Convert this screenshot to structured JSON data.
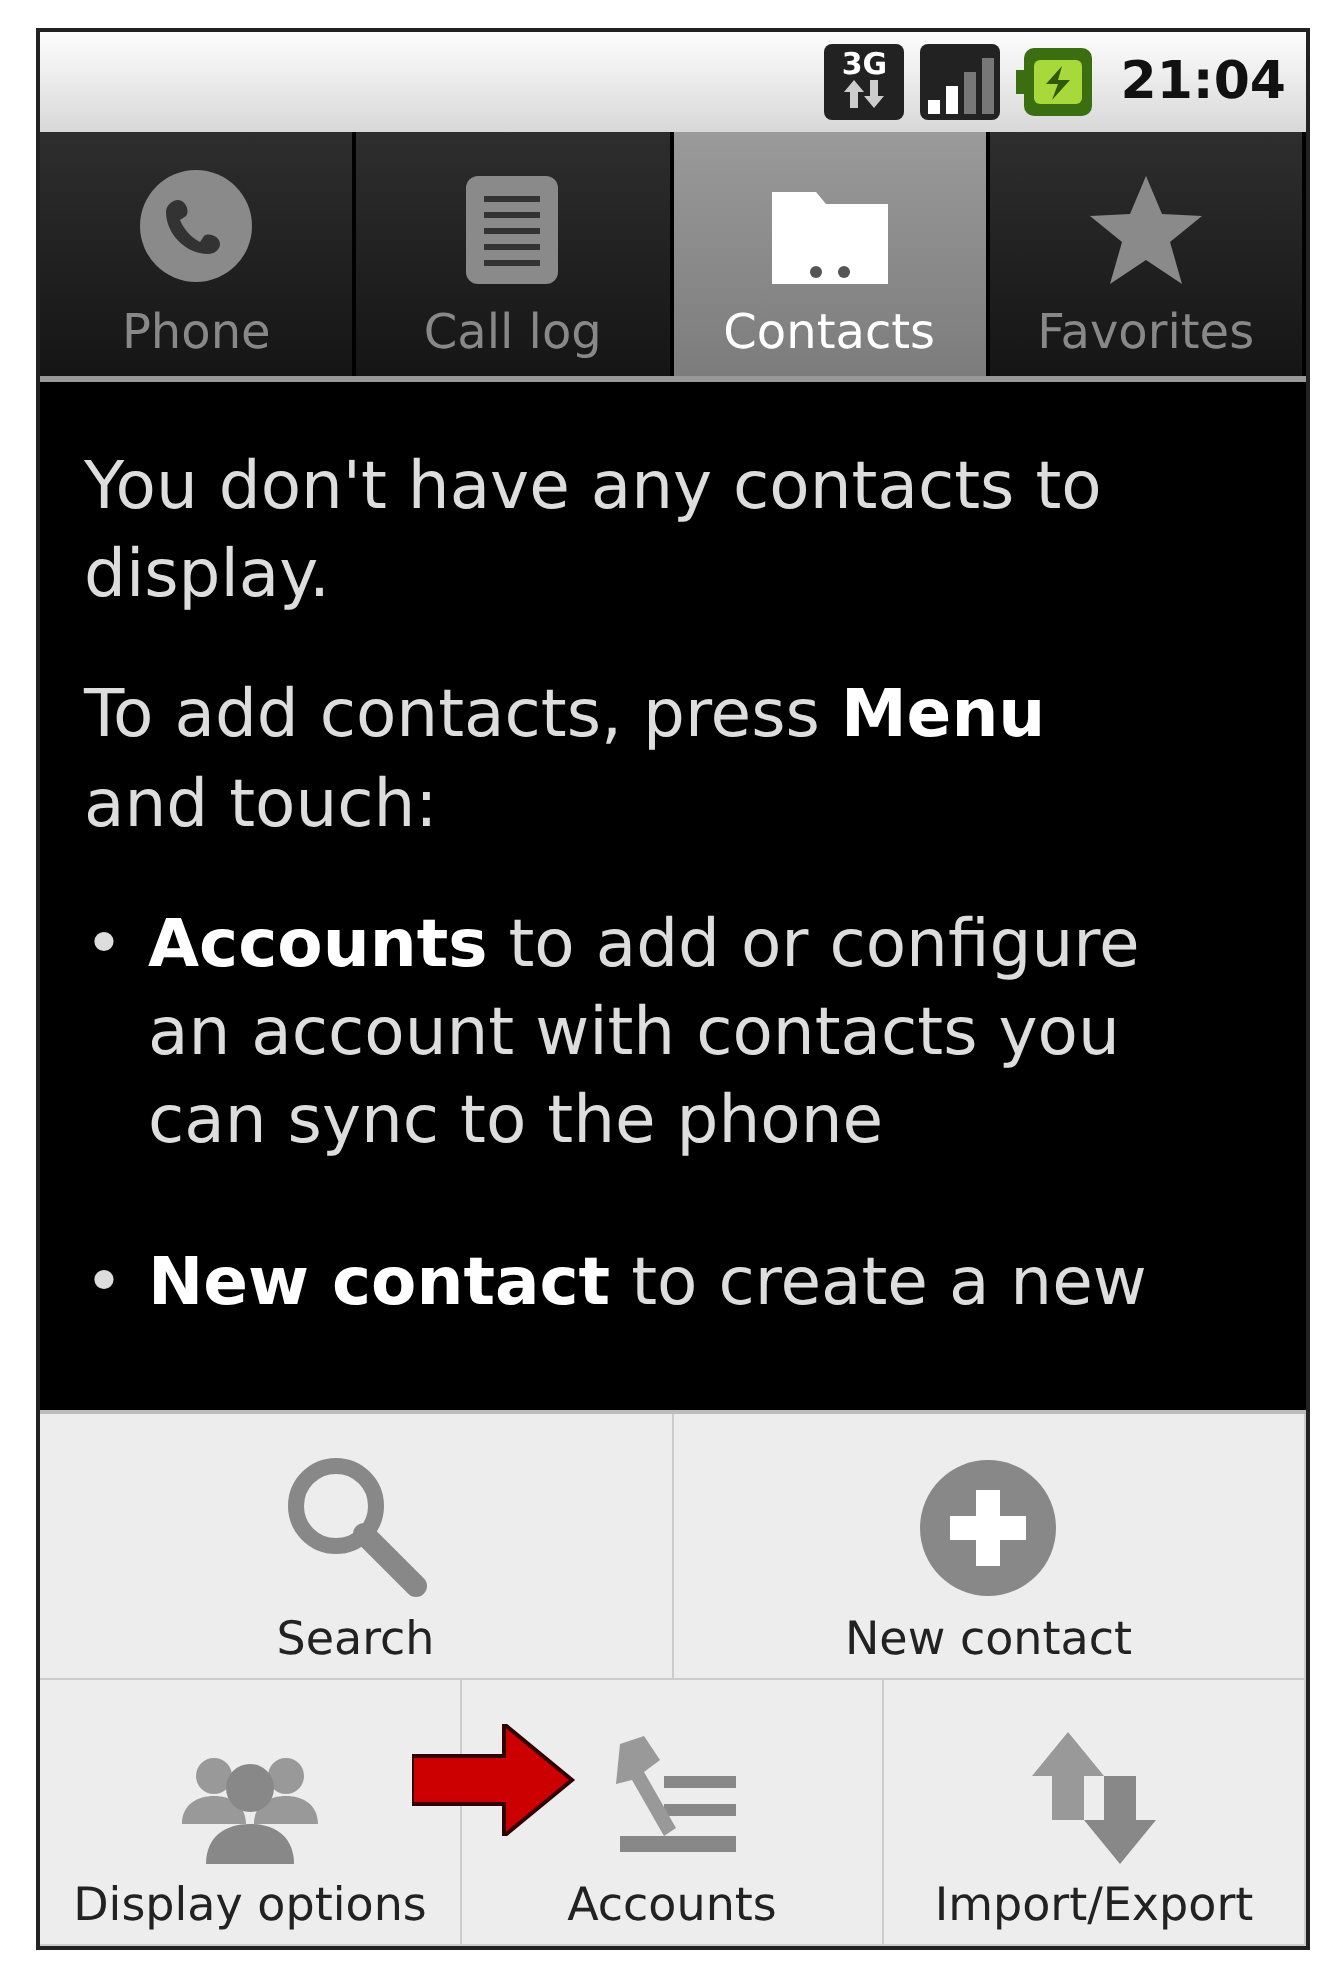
{
  "status_bar": {
    "network": "3G",
    "time": "21:04"
  },
  "tabs": [
    {
      "label": "Phone",
      "kind": "phone",
      "selected": false
    },
    {
      "label": "Call log",
      "kind": "log",
      "selected": false
    },
    {
      "label": "Contacts",
      "kind": "folder",
      "selected": true
    },
    {
      "label": "Favorites",
      "kind": "star",
      "selected": false
    }
  ],
  "message": {
    "paragraphs": [
      "You don't have any contacts to display.",
      "To add contacts, press **Menu** and touch:"
    ],
    "bullets": [
      {
        "mark": "•",
        "text": "**Accounts** to add or configure an account with contacts you can sync to the phone"
      },
      {
        "mark": "•",
        "text": "**New contact** to create a new"
      }
    ]
  },
  "menu": {
    "upper_items": [
      {
        "label": "Search",
        "kind": "search"
      },
      {
        "label": "New contact",
        "kind": "plus"
      }
    ],
    "lower_items": [
      {
        "label": "Display options",
        "kind": "people",
        "highlighted": false
      },
      {
        "label": "Accounts",
        "kind": "accounts",
        "highlighted": true
      },
      {
        "label": "Import/Export",
        "kind": "updown",
        "highlighted": false
      }
    ]
  }
}
